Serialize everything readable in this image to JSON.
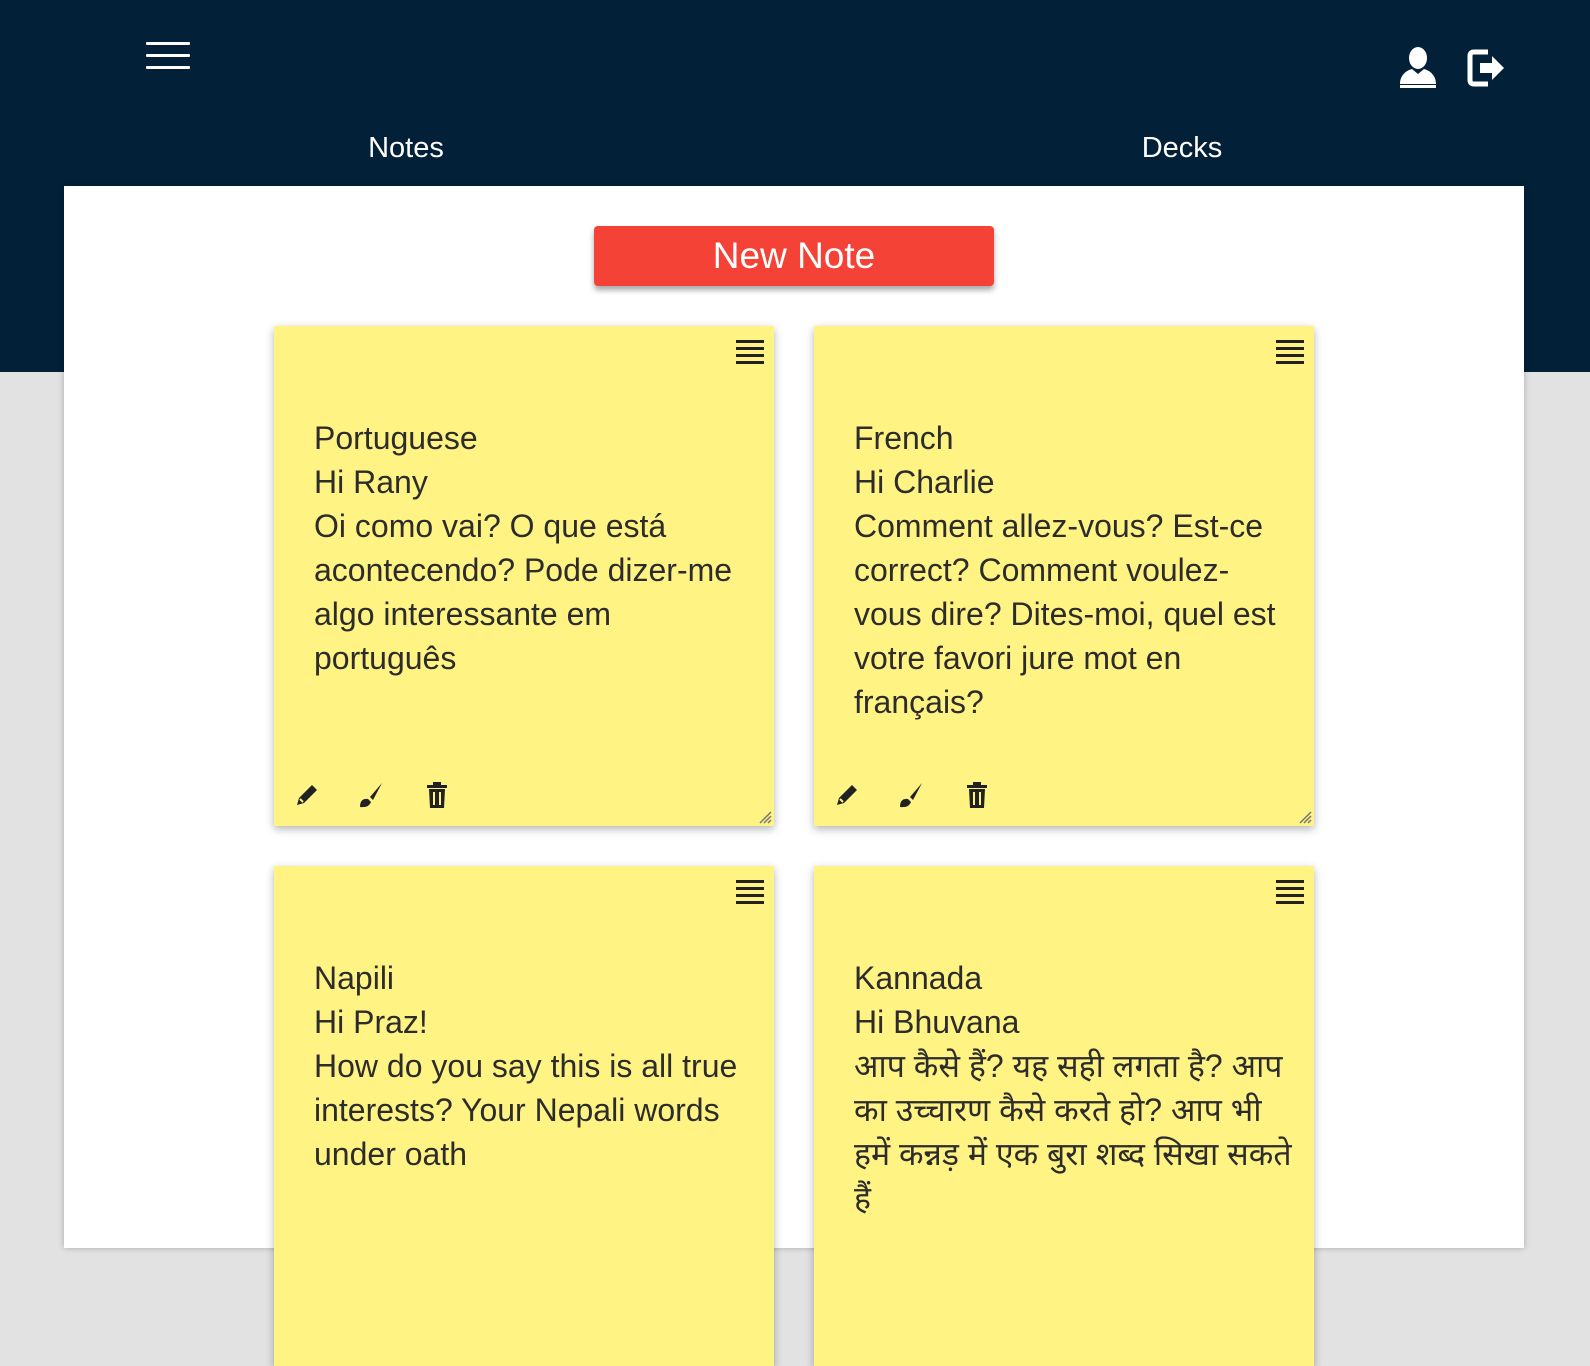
{
  "header": {
    "tabs": [
      {
        "label": "Notes"
      },
      {
        "label": "Decks"
      }
    ]
  },
  "icons": {
    "menu": "hamburger-menu-icon",
    "user": "user-icon",
    "logout": "logout-icon",
    "note_menu": "list-icon",
    "edit": "pencil-icon",
    "color": "paintbrush-icon",
    "delete": "trash-icon"
  },
  "colors": {
    "header_bg": "#022138",
    "accent": "#f44336",
    "note_bg": "#fff383"
  },
  "new_note_label": "New Note",
  "notes": [
    {
      "title": "Portuguese",
      "greeting": "Hi Rany",
      "content": "Oi como vai? O que está acontecendo? Pode dizer-me algo interessante em português"
    },
    {
      "title": "French",
      "greeting": "Hi Charlie",
      "content": "Comment allez-vous? Est-ce correct? Comment voulez-vous dire? Dites-moi, quel est votre favori jure mot en français?"
    },
    {
      "title": "Napili",
      "greeting": "Hi Praz!",
      "content": "How do you say this is all true interests? Your Nepali words under oath"
    },
    {
      "title": "Kannada",
      "greeting": "Hi Bhuvana",
      "content": "आप कैसे हैं? यह सही लगता है? आप का उच्चारण कैसे करते हो? आप भी हमें कन्नड़ में एक बुरा शब्द सिखा सकते हैं"
    }
  ]
}
